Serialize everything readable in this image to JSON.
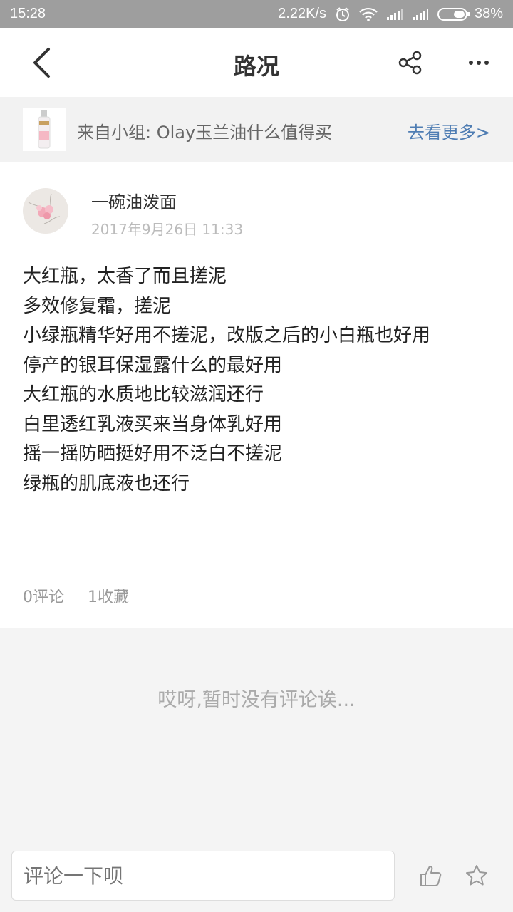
{
  "status_bar": {
    "time": "15:28",
    "network_speed": "2.22K/s",
    "battery": "38%",
    "icons": [
      "alarm-icon",
      "wifi-icon",
      "signal-icon",
      "signal-icon",
      "battery-icon"
    ]
  },
  "header": {
    "title": "路况",
    "icons": [
      "back-chevron-icon",
      "share-icon",
      "more-dots-icon"
    ]
  },
  "group": {
    "text": "来自小组: Olay玉兰油什么值得买",
    "see_more": "去看更多>"
  },
  "post": {
    "author": "一碗油泼面",
    "date": "2017年9月26日 11:33",
    "lines": [
      "大红瓶，太香了而且搓泥",
      "多效修复霜，搓泥",
      "小绿瓶精华好用不搓泥，改版之后的小白瓶也好用",
      "停产的银耳保湿露什么的最好用",
      "大红瓶的水质地比较滋润还行",
      "白里透红乳液买来当身体乳好用",
      "摇一摇防晒挺好用不泛白不搓泥",
      "绿瓶的肌底液也还行"
    ],
    "comments": "0评论",
    "favorites": "1收藏"
  },
  "comments_empty": "哎呀,暂时没有评论诶...",
  "bottom_bar": {
    "placeholder": "评论一下呗",
    "icons": [
      "thumbs-up-icon",
      "star-icon"
    ]
  },
  "colors": {
    "link": "#4f7db3",
    "status_bar": "#9e9e9e",
    "background": "#f4f4f4"
  }
}
